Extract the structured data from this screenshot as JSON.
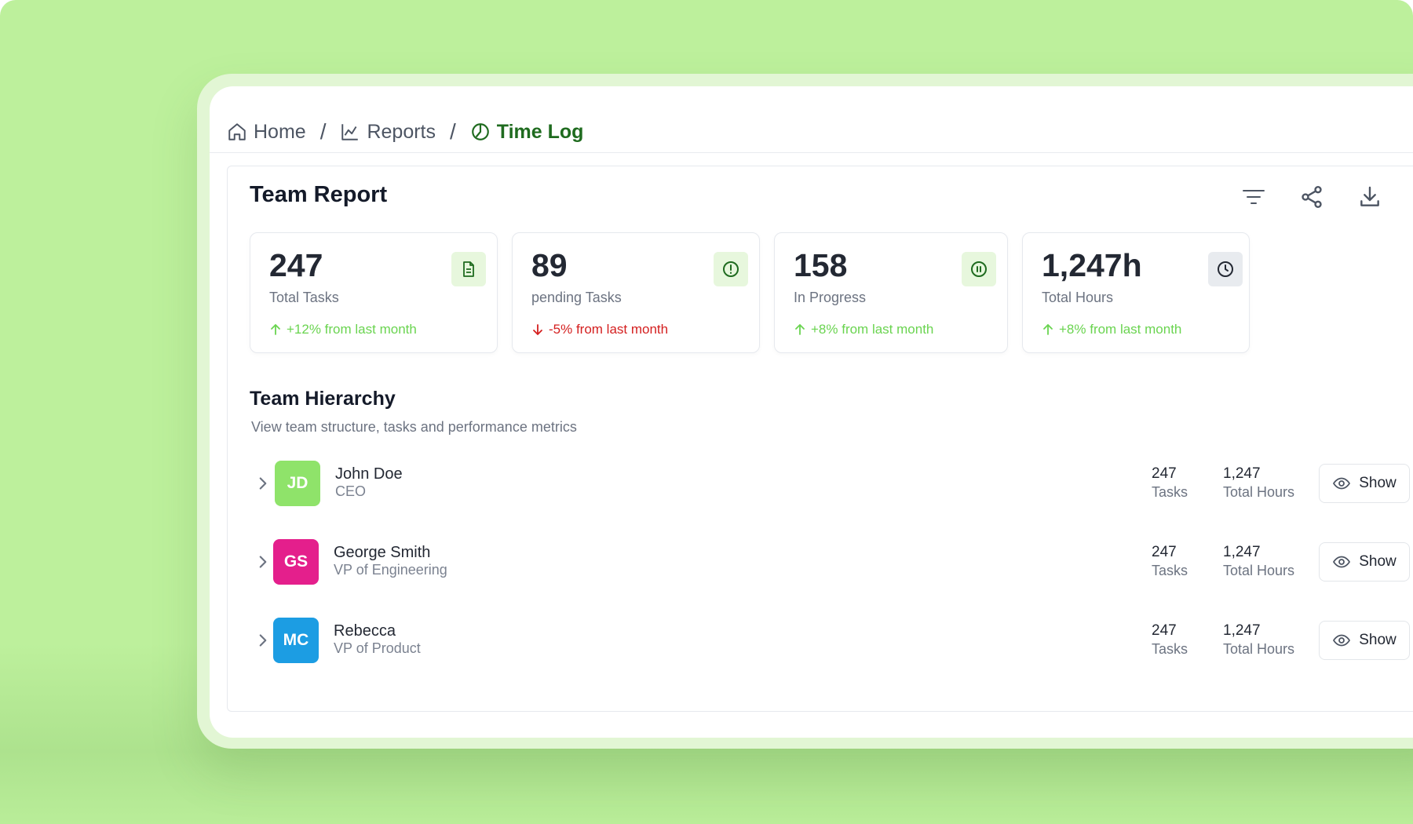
{
  "breadcrumb": {
    "items": [
      {
        "label": "Home",
        "icon": "home-icon"
      },
      {
        "label": "Reports",
        "icon": "chart-line-icon"
      },
      {
        "label": "Time Log",
        "icon": "pie-chart-icon"
      }
    ],
    "separator": "/"
  },
  "report": {
    "title": "Team Report",
    "tools": [
      "filter-icon",
      "share-icon",
      "download-icon"
    ]
  },
  "stats": [
    {
      "value": "247",
      "label": "Total Tasks",
      "delta": "+12% from last month",
      "trend": "up",
      "icon": "document-icon",
      "icon_bg": "#e7f7dd",
      "icon_color": "#1f6b1f"
    },
    {
      "value": "89",
      "label": "pending Tasks",
      "delta": "-5% from last month",
      "trend": "down",
      "icon": "alert-circle-icon",
      "icon_bg": "#e7f7dd",
      "icon_color": "#1f6b1f"
    },
    {
      "value": "158",
      "label": "In Progress",
      "delta": "+8% from last month",
      "trend": "up",
      "icon": "pause-circle-icon",
      "icon_bg": "#e7f7dd",
      "icon_color": "#1f6b1f"
    },
    {
      "value": "1,247h",
      "label": "Total Hours",
      "delta": "+8% from last month",
      "trend": "up",
      "icon": "clock-icon",
      "icon_bg": "#e8ebef",
      "icon_color": "#232833"
    }
  ],
  "hierarchy": {
    "title": "Team Hierarchy",
    "subtitle": "View team structure, tasks and performance metrics",
    "members": [
      {
        "initials": "JD",
        "name": "John Doe",
        "role": "CEO",
        "avatar_color": "#8fe36a",
        "tasks": "247",
        "tasks_label": "Tasks",
        "hours": "1,247",
        "hours_label": "Total Hours",
        "action": "Show"
      },
      {
        "initials": "GS",
        "name": "George Smith",
        "role": "VP of Engineering",
        "avatar_color": "#e41f8c",
        "tasks": "247",
        "tasks_label": "Tasks",
        "hours": "1,247",
        "hours_label": "Total Hours",
        "action": "Show"
      },
      {
        "initials": "MC",
        "name": "Rebecca",
        "role": "VP of Product",
        "avatar_color": "#1c9de3",
        "tasks": "247",
        "tasks_label": "Tasks",
        "hours": "1,247",
        "hours_label": "Total Hours",
        "action": "Show"
      }
    ]
  },
  "colors": {
    "background": "#bdf09c",
    "accent": "#1f6b1f",
    "trend_up": "#6ad450",
    "trend_down": "#d41f1f"
  }
}
